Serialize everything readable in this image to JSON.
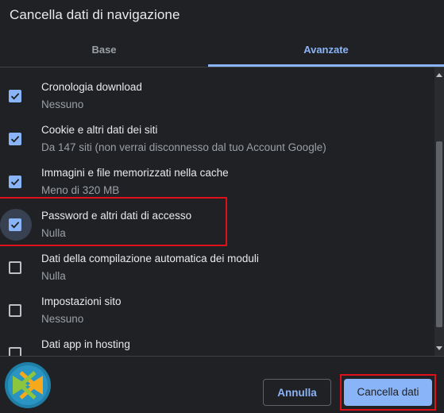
{
  "dialog": {
    "title": "Cancella dati di navigazione"
  },
  "tabs": [
    {
      "label": "Base",
      "active": false
    },
    {
      "label": "Avanzate",
      "active": true
    }
  ],
  "items": [
    {
      "label": "Cronologia download",
      "sub": "Nessuno",
      "checked": true
    },
    {
      "label": "Cookie e altri dati dei siti",
      "sub": "Da 147 siti (non verrai disconnesso dal tuo Account Google)",
      "checked": true
    },
    {
      "label": "Immagini e file memorizzati nella cache",
      "sub": "Meno di 320 MB",
      "checked": true
    },
    {
      "label": "Password e altri dati di accesso",
      "sub": "Nulla",
      "checked": true,
      "highlighted": true
    },
    {
      "label": "Dati della compilazione automatica dei moduli",
      "sub": "Nulla",
      "checked": false
    },
    {
      "label": "Impostazioni sito",
      "sub": "Nessuno",
      "checked": false
    },
    {
      "label": "Dati app in hosting",
      "sub": "",
      "checked": false
    }
  ],
  "buttons": {
    "cancel_label": "Annulla",
    "confirm_label": "Cancella dati"
  },
  "colors": {
    "accent": "#8ab4f8",
    "background": "#202124",
    "annotation": "#e0101a"
  },
  "icons": {
    "checkbox_checked": "check-icon",
    "logo": "app-logo-icon"
  }
}
